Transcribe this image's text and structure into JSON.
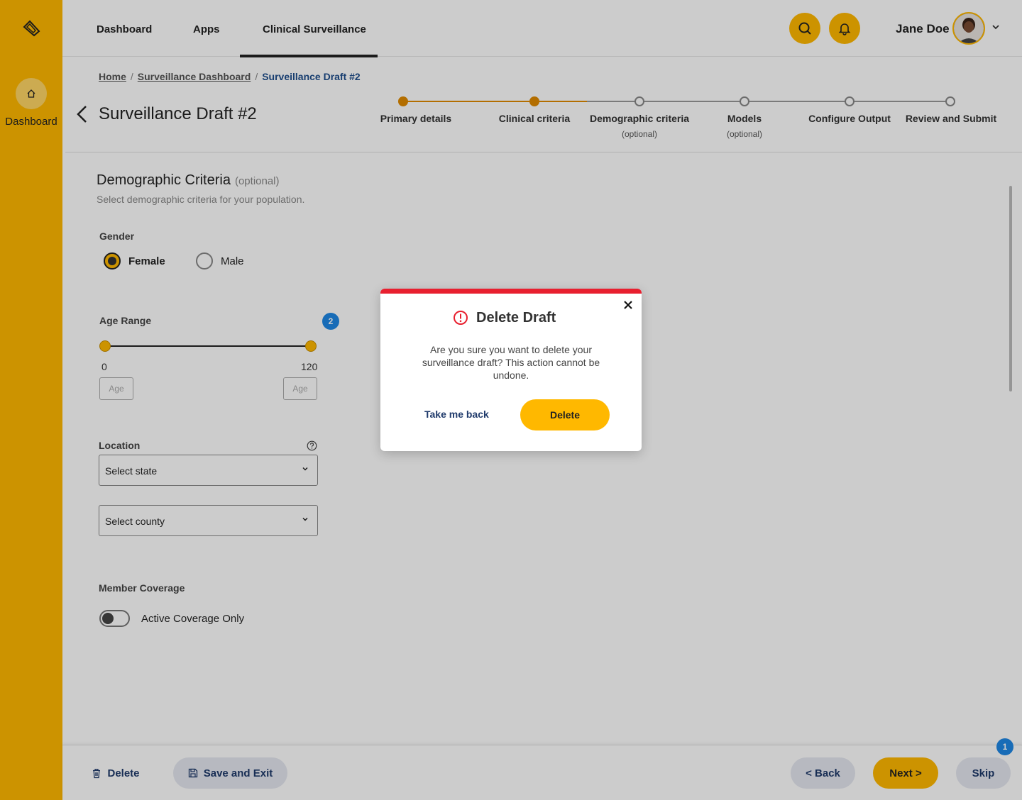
{
  "sidebar": {
    "home_label": "Dashboard"
  },
  "nav": {
    "items": [
      "Dashboard",
      "Apps",
      "Clinical Surveillance"
    ],
    "user_name": "Jane Doe"
  },
  "breadcrumb": [
    "Home",
    "Surveillance Dashboard",
    "Surveillance Draft #2"
  ],
  "page_title": "Surveillance Draft #2",
  "stepper": [
    {
      "label": "Primary details",
      "sub": "",
      "state": "done"
    },
    {
      "label": "Clinical criteria",
      "sub": "",
      "state": "done"
    },
    {
      "label": "Demographic criteria",
      "sub": "(optional)",
      "state": "todo"
    },
    {
      "label": "Models",
      "sub": "(optional)",
      "state": "todo"
    },
    {
      "label": "Configure Output",
      "sub": "",
      "state": "todo"
    },
    {
      "label": "Review and Submit",
      "sub": "",
      "state": "todo"
    }
  ],
  "section": {
    "title": "Demographic Criteria",
    "optional": "(optional)",
    "description": "Select demographic criteria for your population."
  },
  "gender": {
    "label": "Gender",
    "options": [
      "Female",
      "Male"
    ],
    "selected": "Female"
  },
  "age": {
    "label": "Age Range",
    "min": "0",
    "max": "120",
    "min_placeholder": "Age",
    "max_placeholder": "Age",
    "badge": "2"
  },
  "location": {
    "label": "Location",
    "state_placeholder": "Select state",
    "county_placeholder": "Select county"
  },
  "coverage": {
    "label": "Member Coverage",
    "toggle_label": "Active Coverage Only"
  },
  "footer": {
    "delete": "Delete",
    "save_exit": "Save and Exit",
    "back": "< Back",
    "next": "Next >",
    "skip": "Skip",
    "skip_badge": "1"
  },
  "modal": {
    "title": "Delete Draft",
    "text": "Are you sure you want to delete your surveillance draft? This action cannot be undone.",
    "cancel": "Take me back",
    "confirm": "Delete"
  },
  "colors": {
    "brand": "#ffb800",
    "step_done": "#e08a00",
    "danger": "#e8202f",
    "link": "#1f3a6b",
    "badge": "#1e88e5"
  }
}
